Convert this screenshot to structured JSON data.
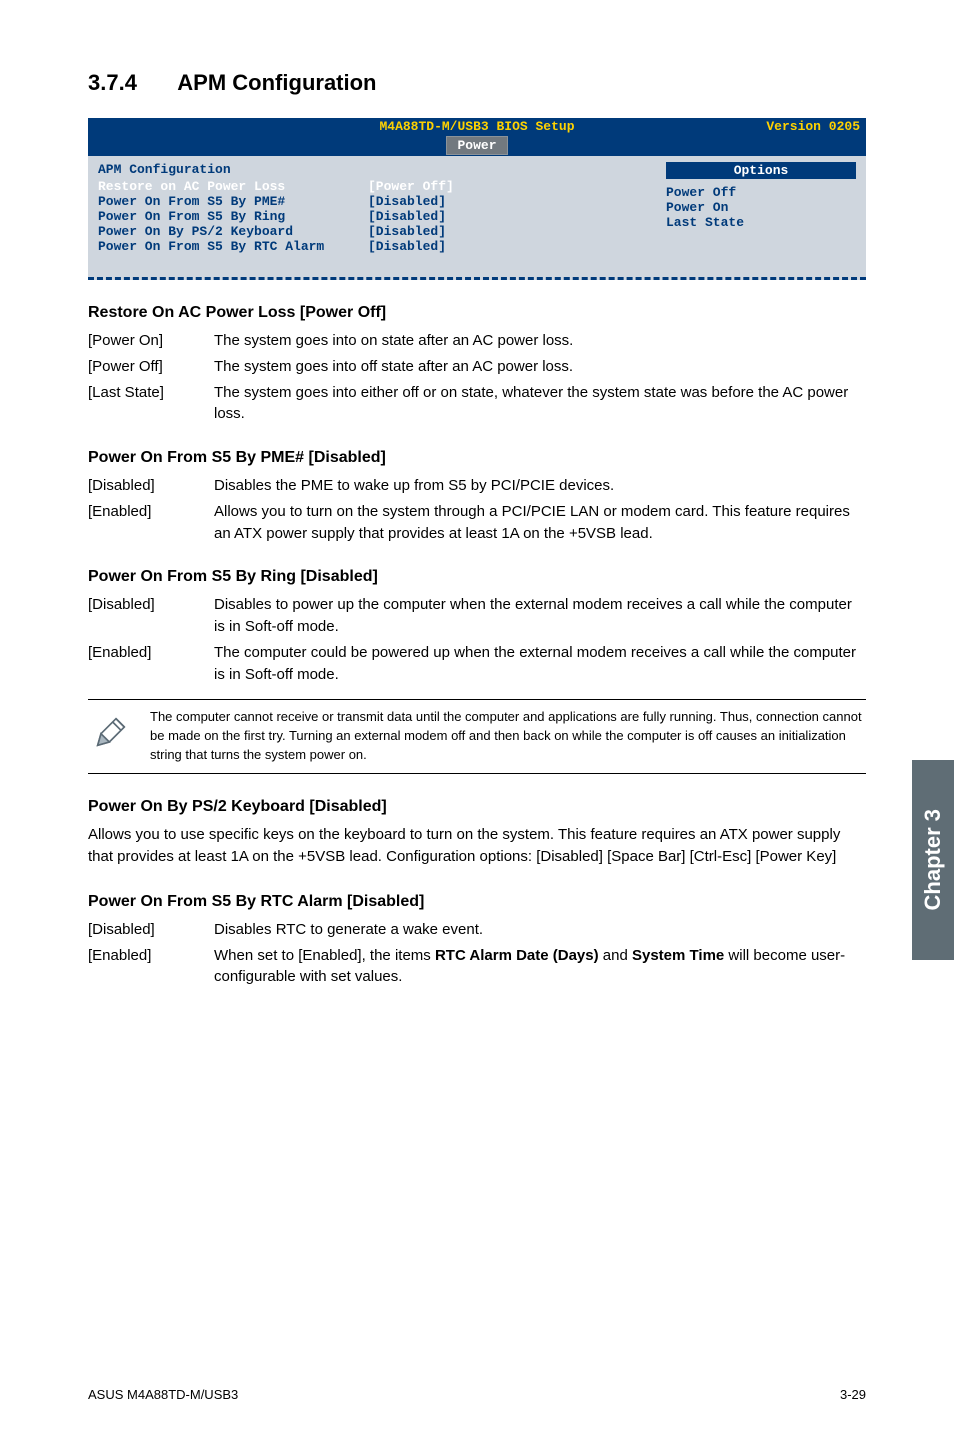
{
  "side_tab": "Chapter 3",
  "section": {
    "number": "3.7.4",
    "title": "APM Configuration"
  },
  "bios": {
    "header_center": "M4A88TD-M/USB3 BIOS Setup",
    "header_right": "Version 0205",
    "tab": "Power",
    "panel_title": "APM Configuration",
    "rows": [
      {
        "label": "Restore on AC Power Loss",
        "value": "[Power Off]",
        "hi": true
      },
      {
        "label": "Power On From S5 By PME#",
        "value": "[Disabled]",
        "hi": false
      },
      {
        "label": "Power On From S5 By Ring",
        "value": "[Disabled]",
        "hi": false
      },
      {
        "label": "Power On By PS/2 Keyboard",
        "value": "[Disabled]",
        "hi": false
      },
      {
        "label": "Power On From S5 By RTC Alarm",
        "value": "[Disabled]",
        "hi": false
      }
    ],
    "options_title": "Options",
    "options": [
      "Power Off",
      "Power On",
      "Last State"
    ]
  },
  "sub1": {
    "heading": "Restore On AC Power Loss [Power Off]",
    "items": [
      {
        "term": "[Power On]",
        "desc": "The system goes into on state after an AC power loss."
      },
      {
        "term": "[Power Off]",
        "desc": "The system goes into off state after an AC power loss."
      },
      {
        "term": "[Last State]",
        "desc": "The system goes into either off or on state, whatever the system state was before the AC power loss."
      }
    ]
  },
  "sub2": {
    "heading": "Power On From S5 By PME# [Disabled]",
    "items": [
      {
        "term": "[Disabled]",
        "desc": "Disables the PME to wake up from S5 by PCI/PCIE devices."
      },
      {
        "term": "[Enabled]",
        "desc": "Allows you to turn on the system through a PCI/PCIE LAN or modem card. This feature requires an ATX power supply that provides at least 1A on the +5VSB lead."
      }
    ]
  },
  "sub3": {
    "heading": "Power On From S5 By Ring [Disabled]",
    "items": [
      {
        "term": "[Disabled]",
        "desc": "Disables to power up the computer when the external modem receives a call while the computer is in Soft-off mode."
      },
      {
        "term": "[Enabled]",
        "desc": "The computer could be powered up when the external modem receives a call while the computer is in Soft-off mode."
      }
    ]
  },
  "note": "The computer cannot receive or transmit data until the computer and applications are fully running. Thus, connection cannot be made on the first try. Turning an external modem off and then back on while the computer is off causes an initialization string that turns the system power on.",
  "sub4": {
    "heading": "Power On By PS/2 Keyboard [Disabled]",
    "para": "Allows you to use specific keys on the keyboard to turn on the system. This feature requires an ATX power supply that provides at least 1A on the +5VSB lead. Configuration options: [Disabled] [Space Bar] [Ctrl-Esc] [Power Key]"
  },
  "sub5": {
    "heading": "Power On From S5 By RTC Alarm [Disabled]",
    "items": [
      {
        "term": "[Disabled]",
        "desc": "Disables RTC to generate a wake event."
      },
      {
        "term": "[Enabled]",
        "desc_pre": "When set to [Enabled], the items ",
        "bold1": "RTC Alarm Date (Days)",
        "mid": " and ",
        "bold2": "System Time",
        "desc_post": " will become user-configurable with set values."
      }
    ]
  },
  "footer_left": "ASUS M4A88TD-M/USB3",
  "footer_right": "3-29"
}
